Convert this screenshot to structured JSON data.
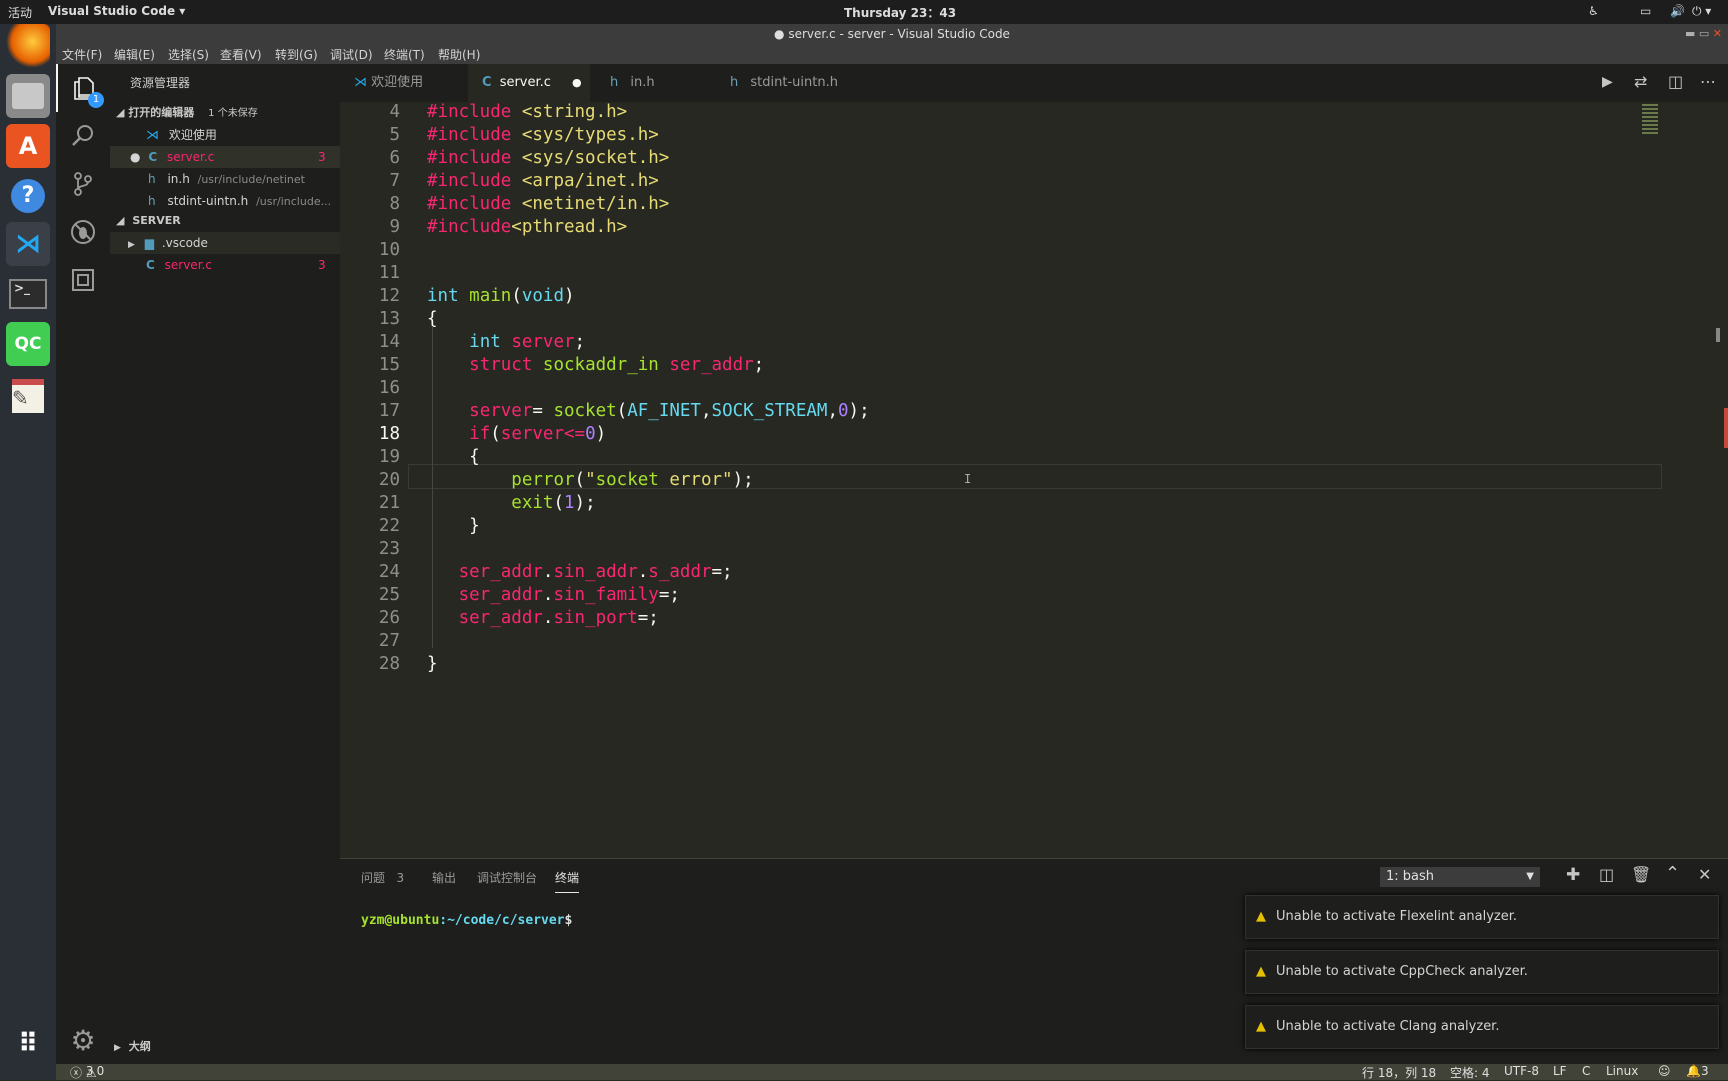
{
  "topbar": {
    "activities": "活动",
    "app_menu": "Visual Studio Code ▾",
    "clock": "Thursday 23：43"
  },
  "window": {
    "title": "server.c - server - Visual Studio Code"
  },
  "menu": [
    "文件(F)",
    "编辑(E)",
    "选择(S)",
    "查看(V)",
    "转到(G)",
    "调试(D)",
    "终端(T)",
    "帮助(H)"
  ],
  "activity": {
    "explorer_badge": "1"
  },
  "sidebar": {
    "header": "资源管理器",
    "open_editors": {
      "title": "打开的编辑器",
      "unsaved": "1 个未保存"
    },
    "open_files": [
      {
        "name": "欢迎使用",
        "path": "",
        "badge": ""
      },
      {
        "name": "server.c",
        "path": "",
        "badge": "3"
      },
      {
        "name": "in.h",
        "path": "/usr/include/netinet",
        "badge": ""
      },
      {
        "name": "stdint-uintn.h",
        "path": "/usr/include...",
        "badge": ""
      }
    ],
    "folder": {
      "title": "SERVER",
      "items": [
        {
          "name": ".vscode",
          "badge": ""
        },
        {
          "name": "server.c",
          "badge": "3"
        }
      ]
    },
    "outline": "大纲"
  },
  "tabs": [
    {
      "label": "欢迎使用",
      "icon": "vscode-icon"
    },
    {
      "label": "server.c",
      "icon": "c-icon",
      "active": true,
      "dirty": true
    },
    {
      "label": "in.h",
      "icon": "h-icon"
    },
    {
      "label": "stdint-uintn.h",
      "icon": "h-icon"
    }
  ],
  "editor": {
    "line_numbers": [
      "4",
      "5",
      "6",
      "7",
      "8",
      "9",
      "10",
      "11",
      "12",
      "13",
      "14",
      "15",
      "16",
      "17",
      "18",
      "19",
      "20",
      "21",
      "22",
      "23",
      "24",
      "25",
      "26",
      "27",
      "28"
    ],
    "lines": [
      "#include <string.h>",
      "#include <sys/types.h>",
      "#include <sys/socket.h>",
      "#include <arpa/inet.h>",
      "#include <netinet/in.h>",
      "#include<pthread.h>",
      "",
      "",
      "int main(void)",
      "{",
      "    int server;",
      "    struct sockaddr_in ser_addr;",
      "",
      "    server= socket(AF_INET,SOCK_STREAM,0);",
      "    if(server<=0)",
      "    {",
      "        perror(\"socket error\");",
      "        exit(1);",
      "    }",
      "",
      "   ser_addr.sin_addr.s_addr=;",
      "   ser_addr.sin_family=;",
      "   ser_addr.sin_port=;",
      "",
      "}"
    ]
  },
  "panel": {
    "tabs": [
      "问题",
      "输出",
      "调试控制台",
      "终端"
    ],
    "problems_count": "3",
    "terminal_select": "1: bash",
    "prompt_user": "yzm@ubuntu",
    "prompt_path": ":~/code/c/server",
    "prompt_sym": "$"
  },
  "notifications": [
    "Unable to activate Flexelint analyzer.",
    "Unable to activate CppCheck analyzer.",
    "Unable to activate Clang analyzer."
  ],
  "status": {
    "errors": "3",
    "warnings": "0",
    "position": "行 18，列 18",
    "spaces": "空格: 4",
    "encoding": "UTF-8",
    "eol": "LF",
    "language": "C",
    "os": "Linux",
    "bell_count": "3"
  },
  "colors": {
    "editor_bg": "#272822",
    "sidebar_bg": "#1e1f1c",
    "keyword": "#f92672",
    "string": "#e6db74",
    "function": "#a6e22e",
    "type": "#66d9ef",
    "number": "#ae81ff"
  }
}
